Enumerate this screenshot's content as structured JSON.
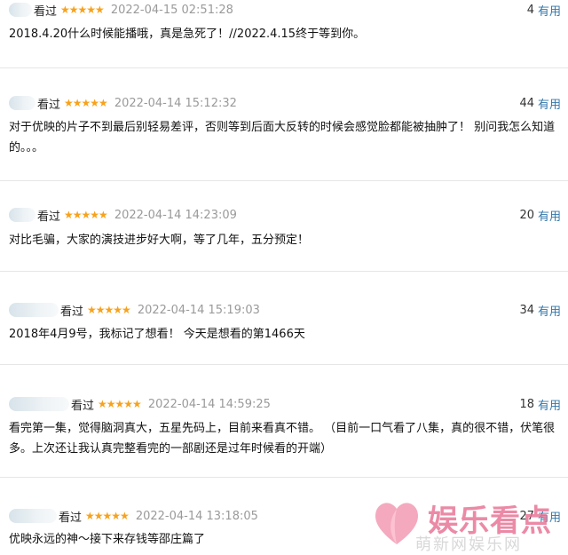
{
  "reviews": [
    {
      "avatar_name": "",
      "status": "看过",
      "rating": 5,
      "stars": "★★★★★",
      "date": "2022-04-15 02:51:28",
      "votes": "4",
      "useful_label": "有用",
      "content": "2018.4.20什么时候能播哦，真是急死了！//2022.4.15终于等到你。"
    },
    {
      "avatar_name": "",
      "status": "看过",
      "rating": 5,
      "stars": "★★★★★",
      "date": "2022-04-14 15:12:32",
      "votes": "44",
      "useful_label": "有用",
      "content": "对于优映的片子不到最后别轻易差评，否则等到后面大反转的时候会感觉脸都能被抽肿了！ 别问我怎么知道的。。。"
    },
    {
      "avatar_name": "",
      "status": "看过",
      "rating": 5,
      "stars": "★★★★★",
      "date": "2022-04-14 14:23:09",
      "votes": "20",
      "useful_label": "有用",
      "content": "对比毛骗，大家的演技进步好大啊，等了几年，五分预定！"
    },
    {
      "avatar_name": "",
      "status": "看过",
      "rating": 5,
      "stars": "★★★★★",
      "date": "2022-04-14 15:19:03",
      "votes": "34",
      "useful_label": "有用",
      "content": "2018年4月9号，我标记了想看！ 今天是想看的第1466天"
    },
    {
      "avatar_name": "",
      "status": "看过",
      "rating": 5,
      "stars": "★★★★★",
      "date": "2022-04-14 14:59:25",
      "votes": "18",
      "useful_label": "有用",
      "content": "看完第一集，觉得脑洞真大，五星先码上，目前来看真不错。 （目前一口气看了八集，真的很不错，伏笔很多。上次还让我认真完整看完的一部剧还是过年时候看的开端）"
    },
    {
      "avatar_name": "",
      "status": "看过",
      "rating": 5,
      "stars": "★★★★★",
      "date": "2022-04-14 13:18:05",
      "votes": "27",
      "useful_label": "有用",
      "content": "优映永远的神～接下来存钱等邵庄篇了"
    }
  ],
  "watermark": {
    "text": "娱乐看点",
    "sub": "萌新网娱乐网"
  },
  "colors": {
    "star": "#f7a21b",
    "link": "#3377aa",
    "date": "#9a9a9a",
    "watermark": "#e87696"
  }
}
